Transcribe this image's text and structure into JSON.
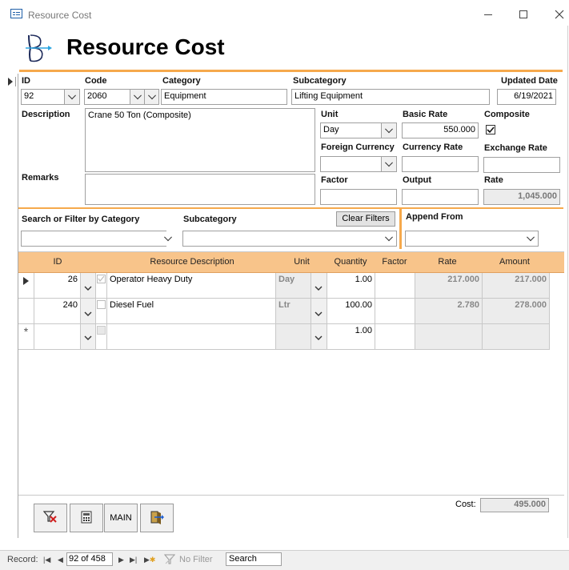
{
  "window": {
    "title": "Resource Cost"
  },
  "header": {
    "title": "Resource Cost"
  },
  "labels": {
    "id": "ID",
    "code": "Code",
    "category": "Category",
    "subcategory": "Subcategory",
    "updated_date": "Updated Date",
    "description": "Description",
    "remarks": "Remarks",
    "unit": "Unit",
    "basic_rate": "Basic Rate",
    "composite": "Composite",
    "foreign_currency": "Foreign Currency",
    "currency_rate": "Currency Rate",
    "exchange_rate": "Exchange Rate",
    "factor": "Factor",
    "output": "Output",
    "rate": "Rate"
  },
  "record": {
    "id": "92",
    "code": "2060",
    "category": "Equipment",
    "subcategory": "Lifting Equipment",
    "updated_date": "6/19/2021",
    "description": "Crane 50 Ton (Composite)",
    "remarks": "",
    "unit": "Day",
    "basic_rate": "550.000",
    "composite": true,
    "foreign_currency": "",
    "currency_rate": "",
    "exchange_rate": "",
    "factor": "",
    "output": "",
    "rate": "1,045.000"
  },
  "filter": {
    "category_label": "Search or Filter by Category",
    "subcategory_label": "Subcategory",
    "clear_filters": "Clear Filters",
    "append_from_label": "Append From"
  },
  "grid": {
    "columns": [
      "ID",
      "Resource Description",
      "Unit",
      "Quantity",
      "Factor",
      "Rate",
      "Amount"
    ],
    "rows": [
      {
        "id": "26",
        "description": "Operator Heavy Duty",
        "unit": "Day",
        "quantity": "1.00",
        "factor": "",
        "rate": "217.000",
        "amount": "217.000",
        "checked": true
      },
      {
        "id": "240",
        "description": "Diesel Fuel",
        "unit": "Ltr",
        "quantity": "100.00",
        "factor": "",
        "rate": "2.780",
        "amount": "278.000",
        "checked": false
      }
    ],
    "new_row": {
      "quantity": "1.00"
    }
  },
  "footer": {
    "main_button": "MAIN",
    "cost_label": "Cost:",
    "cost_value": "495.000"
  },
  "navigation": {
    "record_label": "Record:",
    "position": "92 of 458",
    "filter_status": "No Filter",
    "search_placeholder": "Search"
  },
  "colors": {
    "accent": "#f6a94c",
    "header_fill": "#f8c48a"
  }
}
